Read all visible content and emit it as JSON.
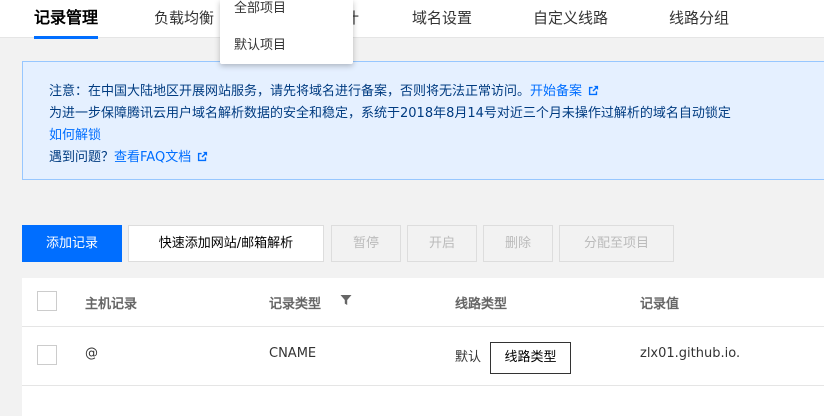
{
  "tabs": [
    {
      "label": "记录管理"
    },
    {
      "label": "负载均衡"
    },
    {
      "label": "计"
    },
    {
      "label": "域名设置"
    },
    {
      "label": "自定义线路"
    },
    {
      "label": "线路分组"
    }
  ],
  "project_dropdown": {
    "options": [
      "全部项目",
      "默认项目"
    ]
  },
  "notice": {
    "line1_text": "注意：在中国大陆地区开展网站服务，请先将域名进行备案，否则将无法正常访问。",
    "line1_link": "开始备案",
    "line2_text": "为进一步保障腾讯云用户域名解析数据的安全和稳定，系统于2018年8月14号对近三个月未操作过解析的域名自动锁定",
    "unlock_link": "如何解锁",
    "faq_text": "遇到问题？",
    "faq_link": "查看FAQ文档",
    "icon": "external-link-icon"
  },
  "toolbar": {
    "add_record": "添加记录",
    "quick_add": "快速添加网站/邮箱解析",
    "pause": "暂停",
    "enable": "开启",
    "delete": "删除",
    "assign_project": "分配至项目"
  },
  "table": {
    "headers": {
      "host": "主机记录",
      "type": "记录类型",
      "line": "线路类型",
      "value": "记录值"
    },
    "rows": [
      {
        "host": "@",
        "type": "CNAME",
        "line": "默认",
        "value": "zlx01.github.io."
      }
    ],
    "tooltip": "线路类型",
    "filter_icon": "filter-icon"
  },
  "colors": {
    "accent": "#006eff",
    "notice_bg": "#e5f0ff",
    "notice_border": "#97c7ff",
    "notice_text": "#003b80"
  }
}
